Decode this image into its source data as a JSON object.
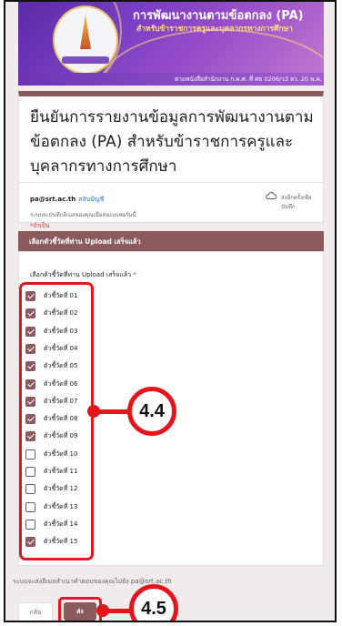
{
  "banner": {
    "title": "การพัฒนางานตามข้อตกลง (PA)",
    "subtitle": "สำหรับข้าราชการครูและบุคลากรทางการศึกษา",
    "reference": "ตามหนังสือสำนักงาน ก.ค.ศ. ที่ ศธ 0206/ว3 ลว. 20 พ.ค. 2564"
  },
  "form": {
    "title": "ยืนยันการรายงานข้อมูลการพัฒนางานตามข้อตกลง (PA) สำหรับข้าราชการครูและบุคลากรทางการศึกษา",
    "email": "pa@srt.ac.th",
    "switch_account": "สลับบัญชี",
    "saved_status": "ส่งอีกครั้งเพื่อบันทึก",
    "autosave_note": "ระบบจะบันทึกอีเมลของคุณเมื่อส่งแบบฟอร์มนี้",
    "required_note": "*จำเป็น"
  },
  "section": {
    "title": "เลือกตัวชี้วัดที่ท่าน Upload เสร็จแล้ว"
  },
  "question": {
    "label": "เลือกตัวชี้วัดที่ท่าน Upload เสร็จแล้ว",
    "required_mark": "*",
    "options": [
      {
        "label": "ตัวชี้วัดที่ 01",
        "checked": true
      },
      {
        "label": "ตัวชี้วัดที่ 02",
        "checked": true
      },
      {
        "label": "ตัวชี้วัดที่ 03",
        "checked": true
      },
      {
        "label": "ตัวชี้วัดที่ 04",
        "checked": true
      },
      {
        "label": "ตัวชี้วัดที่ 05",
        "checked": true
      },
      {
        "label": "ตัวชี้วัดที่ 06",
        "checked": true
      },
      {
        "label": "ตัวชี้วัดที่ 07",
        "checked": true
      },
      {
        "label": "ตัวชี้วัดที่ 08",
        "checked": true
      },
      {
        "label": "ตัวชี้วัดที่ 09",
        "checked": true
      },
      {
        "label": "ตัวชี้วัดที่ 10",
        "checked": false
      },
      {
        "label": "ตัวชี้วัดที่ 11",
        "checked": false
      },
      {
        "label": "ตัวชี้วัดที่ 12",
        "checked": false
      },
      {
        "label": "ตัวชี้วัดที่ 13",
        "checked": false
      },
      {
        "label": "ตัวชี้วัดที่ 14",
        "checked": false
      },
      {
        "label": "ตัวชี้วัดที่ 15",
        "checked": true
      }
    ]
  },
  "footer": {
    "note": "ระบบจะส่งอีเมลสำเนาคำตอบของคุณไปยัง pa@srt.ac.th",
    "back_label": "กลับ",
    "submit_label": "ส่ง"
  },
  "annotations": {
    "marker_1": "4.4",
    "marker_2": "4.5"
  },
  "colors": {
    "theme": "#8b5a5f",
    "annotation_red": "#e8141c",
    "link_blue": "#1a73e8"
  }
}
